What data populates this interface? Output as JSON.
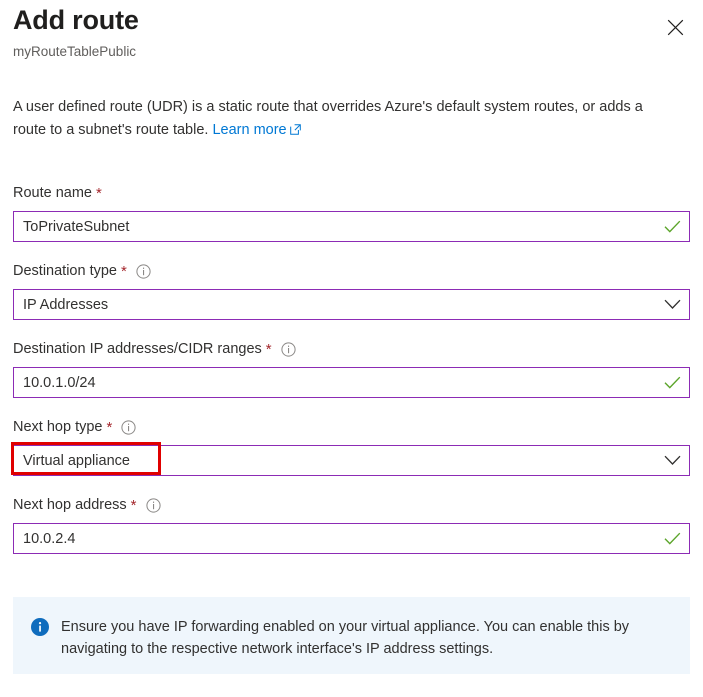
{
  "header": {
    "title": "Add route",
    "subtitle": "myRouteTablePublic",
    "close_label": "Close",
    "close_icon": "close-icon"
  },
  "description": {
    "text_before": "A user defined route (UDR) is a static route that overrides Azure's default system routes, or adds a route to a subnet's route table.",
    "link_label": "Learn more",
    "link_icon": "external-link-icon"
  },
  "form": {
    "fields": [
      {
        "label": "Route name",
        "required": true,
        "has_info": false,
        "type": "text",
        "value": "ToPrivateSubnet",
        "placeholder": "",
        "trailing_icon": "checkmark-icon",
        "validated": true,
        "highlighted": false
      },
      {
        "label": "Destination type",
        "required": true,
        "has_info": true,
        "type": "select",
        "value": "IP Addresses",
        "placeholder": "",
        "trailing_icon": "chevron-down-icon",
        "validated": false,
        "highlighted": false
      },
      {
        "label": "Destination IP addresses/CIDR ranges",
        "required": true,
        "has_info": true,
        "type": "text",
        "value": "10.0.1.0/24",
        "placeholder": "",
        "trailing_icon": "checkmark-icon",
        "validated": true,
        "highlighted": false
      },
      {
        "label": "Next hop type",
        "required": true,
        "has_info": true,
        "type": "select",
        "value": "Virtual appliance",
        "placeholder": "",
        "trailing_icon": "chevron-down-icon",
        "validated": false,
        "highlighted": true
      },
      {
        "label": "Next hop address",
        "required": true,
        "has_info": true,
        "type": "text",
        "value": "10.0.2.4",
        "placeholder": "",
        "trailing_icon": "checkmark-icon",
        "validated": true,
        "highlighted": false
      }
    ]
  },
  "info_banner": {
    "icon": "info-circle-icon",
    "text": "Ensure you have IP forwarding enabled on your virtual appliance. You can enable this by navigating to the respective network interface's IP address settings."
  },
  "colors": {
    "accent_link": "#0078d4",
    "field_border": "#8c2bb5",
    "required_star": "#a4262c",
    "success_check": "#5ca52b",
    "annotation_red": "#e00000",
    "banner_bg": "#eff6fc",
    "banner_icon": "#0f6cbd",
    "text_primary": "#323130",
    "text_secondary": "#605e5c"
  }
}
